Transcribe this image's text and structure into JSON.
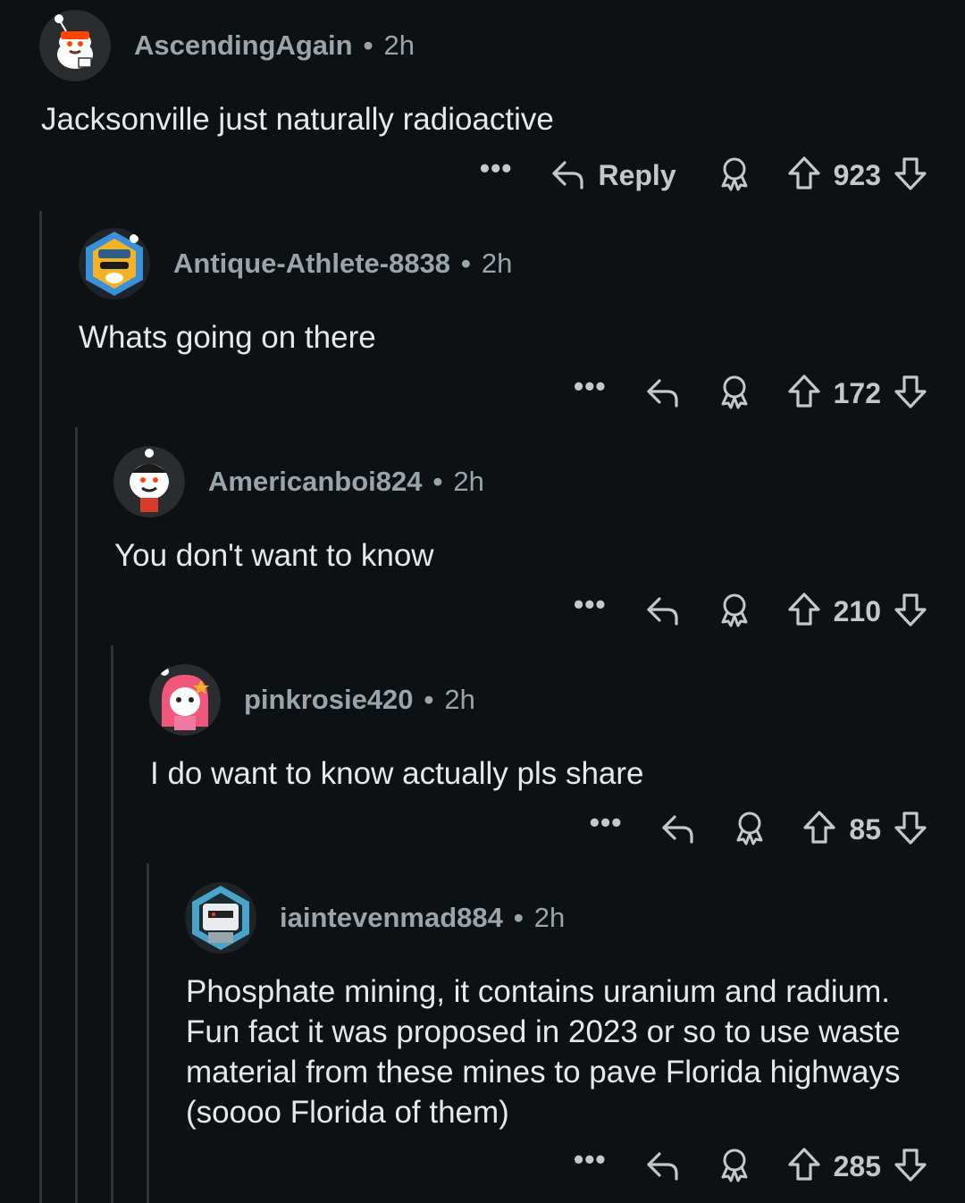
{
  "comments": [
    {
      "username": "AscendingAgain",
      "time": "2h",
      "text": "Jacksonville just naturally radioactive",
      "score": "923",
      "reply_label": "Reply",
      "more": "•••"
    },
    {
      "username": "Antique-Athlete-8838",
      "time": "2h",
      "text": "Whats going on there",
      "score": "172",
      "more": "•••"
    },
    {
      "username": "Americanboi824",
      "time": "2h",
      "text": "You don't want to know",
      "score": "210",
      "more": "•••"
    },
    {
      "username": "pinkrosie420",
      "time": "2h",
      "text": "I do want to know actually pls share",
      "score": "85",
      "more": "•••"
    },
    {
      "username": "iaintevenmad884",
      "time": "2h",
      "text": "Phosphate mining, it contains uranium and radium. Fun fact it was proposed in 2023 or so to use waste material from these mines to pave Florida highways (soooo Florida of them)",
      "score": "285",
      "more": "•••"
    }
  ],
  "separator": "•",
  "icons": {
    "reply": "reply-arrow-icon",
    "award": "award-icon",
    "upvote": "upvote-arrow-icon",
    "downvote": "downvote-arrow-icon"
  },
  "colors": {
    "background": "#0e1113",
    "text": "#e6e8ea",
    "meta": "#9aa4ab",
    "thread_line": "#2f3336"
  }
}
